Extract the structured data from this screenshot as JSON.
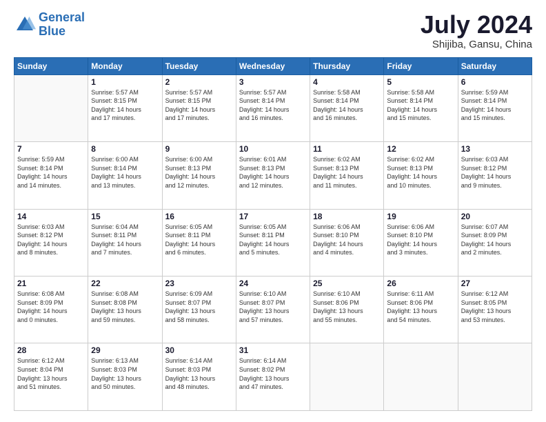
{
  "header": {
    "logo_line1": "General",
    "logo_line2": "Blue",
    "title": "July 2024",
    "subtitle": "Shijiba, Gansu, China"
  },
  "columns": [
    "Sunday",
    "Monday",
    "Tuesday",
    "Wednesday",
    "Thursday",
    "Friday",
    "Saturday"
  ],
  "weeks": [
    [
      {
        "day": "",
        "info": ""
      },
      {
        "day": "1",
        "info": "Sunrise: 5:57 AM\nSunset: 8:15 PM\nDaylight: 14 hours\nand 17 minutes."
      },
      {
        "day": "2",
        "info": "Sunrise: 5:57 AM\nSunset: 8:15 PM\nDaylight: 14 hours\nand 17 minutes."
      },
      {
        "day": "3",
        "info": "Sunrise: 5:57 AM\nSunset: 8:14 PM\nDaylight: 14 hours\nand 16 minutes."
      },
      {
        "day": "4",
        "info": "Sunrise: 5:58 AM\nSunset: 8:14 PM\nDaylight: 14 hours\nand 16 minutes."
      },
      {
        "day": "5",
        "info": "Sunrise: 5:58 AM\nSunset: 8:14 PM\nDaylight: 14 hours\nand 15 minutes."
      },
      {
        "day": "6",
        "info": "Sunrise: 5:59 AM\nSunset: 8:14 PM\nDaylight: 14 hours\nand 15 minutes."
      }
    ],
    [
      {
        "day": "7",
        "info": "Sunrise: 5:59 AM\nSunset: 8:14 PM\nDaylight: 14 hours\nand 14 minutes."
      },
      {
        "day": "8",
        "info": "Sunrise: 6:00 AM\nSunset: 8:14 PM\nDaylight: 14 hours\nand 13 minutes."
      },
      {
        "day": "9",
        "info": "Sunrise: 6:00 AM\nSunset: 8:13 PM\nDaylight: 14 hours\nand 12 minutes."
      },
      {
        "day": "10",
        "info": "Sunrise: 6:01 AM\nSunset: 8:13 PM\nDaylight: 14 hours\nand 12 minutes."
      },
      {
        "day": "11",
        "info": "Sunrise: 6:02 AM\nSunset: 8:13 PM\nDaylight: 14 hours\nand 11 minutes."
      },
      {
        "day": "12",
        "info": "Sunrise: 6:02 AM\nSunset: 8:13 PM\nDaylight: 14 hours\nand 10 minutes."
      },
      {
        "day": "13",
        "info": "Sunrise: 6:03 AM\nSunset: 8:12 PM\nDaylight: 14 hours\nand 9 minutes."
      }
    ],
    [
      {
        "day": "14",
        "info": "Sunrise: 6:03 AM\nSunset: 8:12 PM\nDaylight: 14 hours\nand 8 minutes."
      },
      {
        "day": "15",
        "info": "Sunrise: 6:04 AM\nSunset: 8:11 PM\nDaylight: 14 hours\nand 7 minutes."
      },
      {
        "day": "16",
        "info": "Sunrise: 6:05 AM\nSunset: 8:11 PM\nDaylight: 14 hours\nand 6 minutes."
      },
      {
        "day": "17",
        "info": "Sunrise: 6:05 AM\nSunset: 8:11 PM\nDaylight: 14 hours\nand 5 minutes."
      },
      {
        "day": "18",
        "info": "Sunrise: 6:06 AM\nSunset: 8:10 PM\nDaylight: 14 hours\nand 4 minutes."
      },
      {
        "day": "19",
        "info": "Sunrise: 6:06 AM\nSunset: 8:10 PM\nDaylight: 14 hours\nand 3 minutes."
      },
      {
        "day": "20",
        "info": "Sunrise: 6:07 AM\nSunset: 8:09 PM\nDaylight: 14 hours\nand 2 minutes."
      }
    ],
    [
      {
        "day": "21",
        "info": "Sunrise: 6:08 AM\nSunset: 8:09 PM\nDaylight: 14 hours\nand 0 minutes."
      },
      {
        "day": "22",
        "info": "Sunrise: 6:08 AM\nSunset: 8:08 PM\nDaylight: 13 hours\nand 59 minutes."
      },
      {
        "day": "23",
        "info": "Sunrise: 6:09 AM\nSunset: 8:07 PM\nDaylight: 13 hours\nand 58 minutes."
      },
      {
        "day": "24",
        "info": "Sunrise: 6:10 AM\nSunset: 8:07 PM\nDaylight: 13 hours\nand 57 minutes."
      },
      {
        "day": "25",
        "info": "Sunrise: 6:10 AM\nSunset: 8:06 PM\nDaylight: 13 hours\nand 55 minutes."
      },
      {
        "day": "26",
        "info": "Sunrise: 6:11 AM\nSunset: 8:06 PM\nDaylight: 13 hours\nand 54 minutes."
      },
      {
        "day": "27",
        "info": "Sunrise: 6:12 AM\nSunset: 8:05 PM\nDaylight: 13 hours\nand 53 minutes."
      }
    ],
    [
      {
        "day": "28",
        "info": "Sunrise: 6:12 AM\nSunset: 8:04 PM\nDaylight: 13 hours\nand 51 minutes."
      },
      {
        "day": "29",
        "info": "Sunrise: 6:13 AM\nSunset: 8:03 PM\nDaylight: 13 hours\nand 50 minutes."
      },
      {
        "day": "30",
        "info": "Sunrise: 6:14 AM\nSunset: 8:03 PM\nDaylight: 13 hours\nand 48 minutes."
      },
      {
        "day": "31",
        "info": "Sunrise: 6:14 AM\nSunset: 8:02 PM\nDaylight: 13 hours\nand 47 minutes."
      },
      {
        "day": "",
        "info": ""
      },
      {
        "day": "",
        "info": ""
      },
      {
        "day": "",
        "info": ""
      }
    ]
  ]
}
